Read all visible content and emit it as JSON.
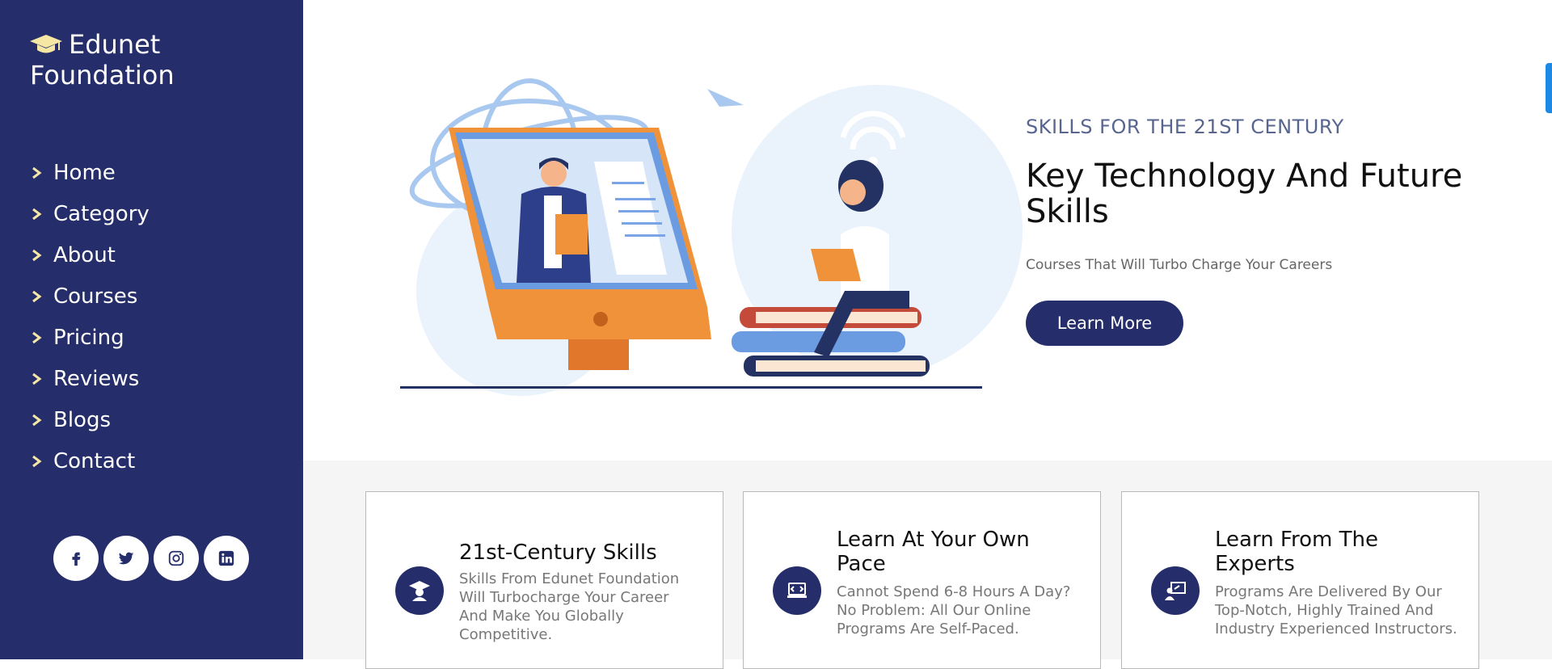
{
  "sidebar": {
    "brand_line1": "Edunet",
    "brand_line2": "Foundation",
    "nav": [
      "Home",
      "Category",
      "About",
      "Courses",
      "Pricing",
      "Reviews",
      "Blogs",
      "Contact"
    ],
    "socials": [
      "facebook-icon",
      "twitter-icon",
      "instagram-icon",
      "linkedin-icon"
    ]
  },
  "hero": {
    "tagline": "SKILLS FOR THE 21ST CENTURY",
    "headline": "Key Technology And Future Skills",
    "subline": "Courses That Will Turbo Charge Your Careers",
    "cta": "Learn More"
  },
  "features": [
    {
      "icon": "graduate-icon",
      "title": "21st-Century Skills",
      "text": "Skills From Edunet Foundation Will Turbocharge Your Career And Make You Globally Competitive."
    },
    {
      "icon": "laptop-code-icon",
      "title": "Learn At Your Own Pace",
      "text": "Cannot Spend 6-8 Hours A Day? No Problem: All Our Online Programs Are Self-Paced."
    },
    {
      "icon": "teacher-board-icon",
      "title": "Learn From The Experts",
      "text": "Programs Are Delivered By Our Top-Notch, Highly Trained And Industry Experienced Instructors."
    }
  ],
  "colors": {
    "primary": "#252e6b",
    "accent_orange": "#f0923a",
    "light_blue": "#e8f0fa"
  }
}
